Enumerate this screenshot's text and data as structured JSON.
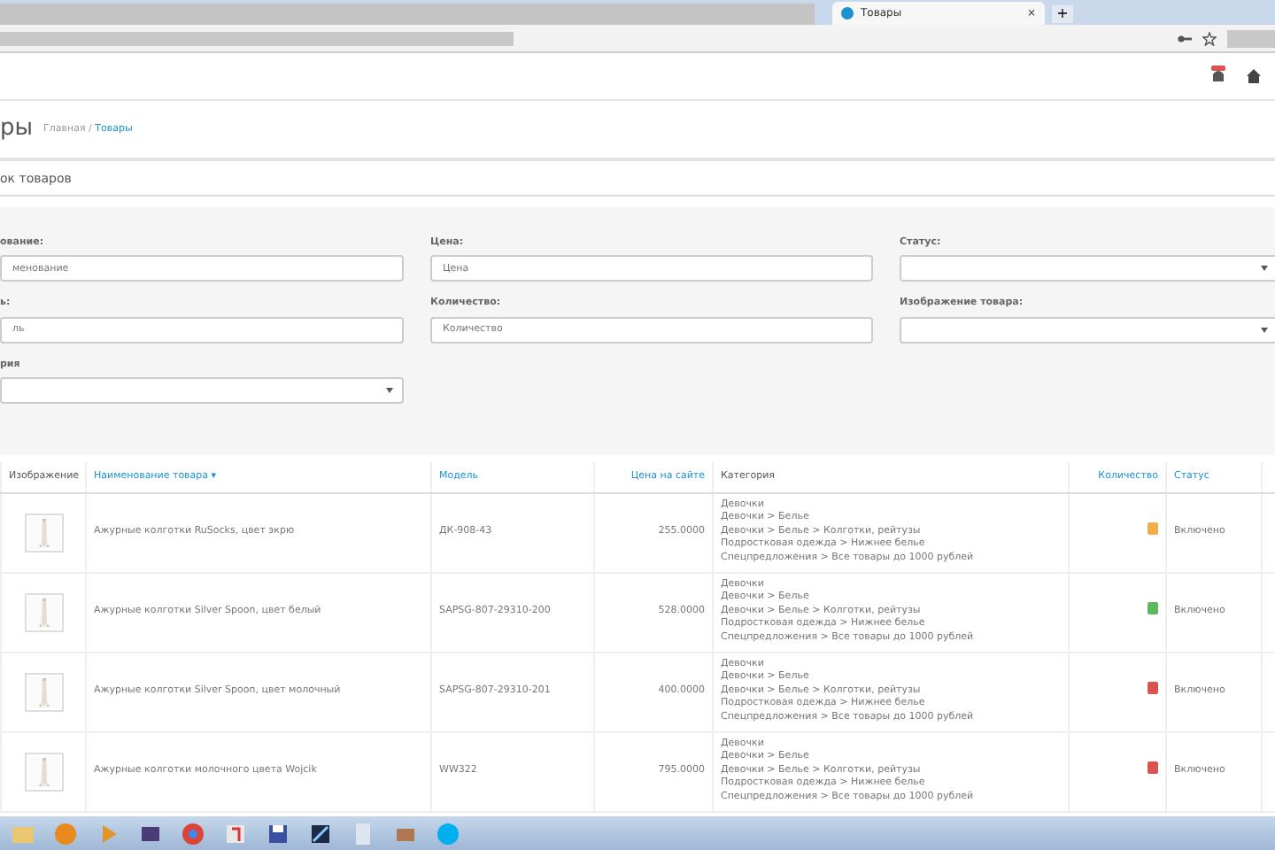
{
  "browser": {
    "tab": {
      "title": "Товары",
      "close": "×"
    },
    "new_tab": "+"
  },
  "page": {
    "title": "ры",
    "breadcrumb_separator": "/",
    "breadcrumb": [
      {
        "label": "Главная",
        "selected": false
      },
      {
        "label": "Товары",
        "selected": true
      }
    ]
  },
  "panel": {
    "title": "ок товаров"
  },
  "filters": [
    {
      "label": "ование:",
      "placeholder": "менование",
      "kind": "text"
    },
    {
      "label": "Цена:",
      "placeholder": "Цена",
      "kind": "text"
    },
    {
      "label": "Статус:",
      "kind": "select"
    },
    {
      "label": "ь:",
      "placeholder": "ль",
      "kind": "text"
    },
    {
      "label": "Количество:",
      "placeholder": "Количество",
      "kind": "text"
    },
    {
      "label": "Изображение товара:",
      "kind": "select"
    },
    {
      "label": "рия",
      "kind": "select"
    }
  ],
  "table": {
    "columns": [
      {
        "label": "Изображение",
        "link": false
      },
      {
        "label": "Наименование товара",
        "link": true,
        "sort": "▾"
      },
      {
        "label": "Модель",
        "link": true
      },
      {
        "label": "Цена на сайте",
        "link": true
      },
      {
        "label": "Категория",
        "link": false
      },
      {
        "label": "Количество",
        "link": true
      },
      {
        "label": "Статус",
        "link": true
      }
    ],
    "rows": [
      {
        "name": "Ажурные колготки RuSocks, цвет экрю",
        "model": "ДК-908-43",
        "price": "255.0000",
        "categories": [
          "Девочки",
          "Девочки > Белье",
          "Девочки > Белье > Колготки, рейтузы",
          "Подростковая одежда > Нижнее белье",
          "Спецпредложения > Все товары до 1000 рублей"
        ],
        "quantity": {
          "color": "#f0ad4e"
        },
        "status": "Включено"
      },
      {
        "name": "Ажурные колготки Silver Spoon, цвет белый",
        "model": "SAPSG-807-29310-200",
        "price": "528.0000",
        "categories": [
          "Девочки",
          "Девочки > Белье",
          "Девочки > Белье > Колготки, рейтузы",
          "Подростковая одежда > Нижнее белье",
          "Спецпредложения > Все товары до 1000 рублей"
        ],
        "quantity": {
          "color": "#5cb85c"
        },
        "status": "Включено"
      },
      {
        "name": "Ажурные колготки Silver Spoon, цвет молочный",
        "model": "SAPSG-807-29310-201",
        "price": "400.0000",
        "categories": [
          "Девочки",
          "Девочки > Белье",
          "Девочки > Белье > Колготки, рейтузы",
          "Подростковая одежда > Нижнее белье",
          "Спецпредложения > Все товары до 1000 рублей"
        ],
        "quantity": {
          "color": "#d9534f"
        },
        "status": "Включено"
      },
      {
        "name": "Ажурные колготки молочного цвета Wojcik",
        "model": "WW322",
        "price": "795.0000",
        "categories": [
          "Девочки",
          "Девочки > Белье",
          "Девочки > Белье > Колготки, рейтузы",
          "Подростковая одежда > Нижнее белье",
          "Спецпредложения > Все товары до 1000 рублей"
        ],
        "quantity": {
          "color": "#d9534f"
        },
        "status": "Включено"
      }
    ]
  }
}
